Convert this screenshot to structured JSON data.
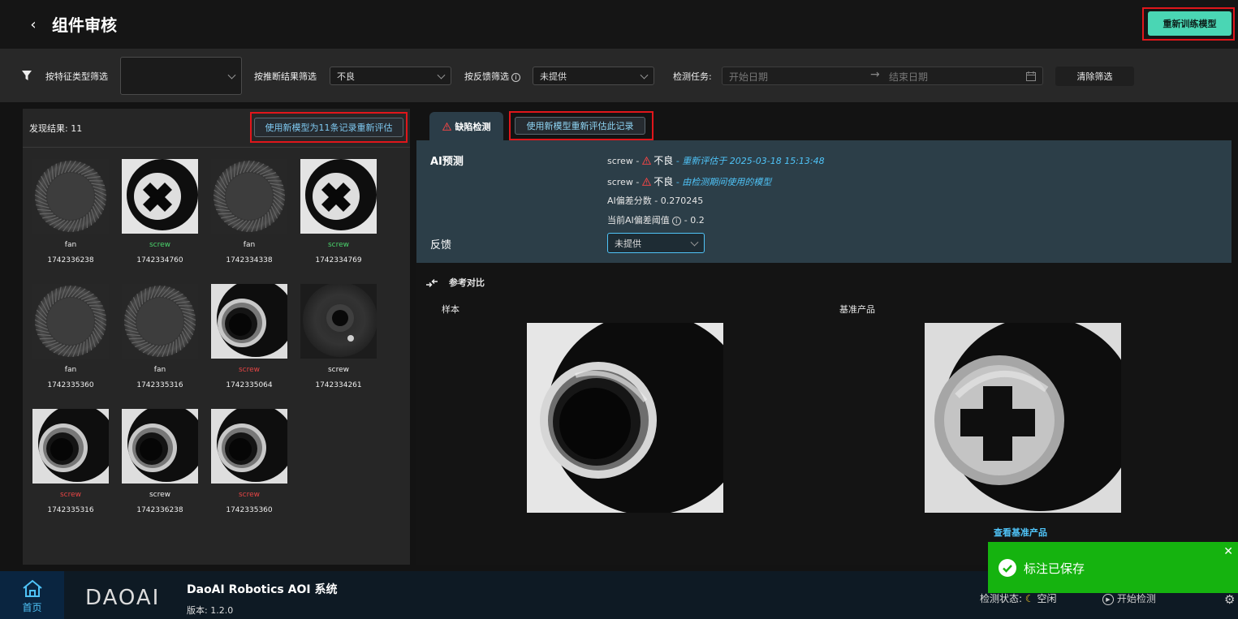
{
  "header": {
    "back_icon": "chevron-left-icon",
    "title": "组件审核",
    "retrain_label": "重新训练模型"
  },
  "filters": {
    "funnel_icon": "funnel-icon",
    "feature_type_label": "按特征类型筛选",
    "feature_type_value": "",
    "result_label": "按推断结果筛选",
    "result_value": "不良",
    "feedback_label": "按反馈筛选",
    "feedback_value": "未提供",
    "task_label": "检测任务:",
    "start_date_placeholder": "开始日期",
    "end_date_placeholder": "结束日期",
    "clear_label": "清除筛选"
  },
  "results": {
    "count_label": "发现结果: 11",
    "reeval_all_label": "使用新模型为11条记录重新评估",
    "items": [
      {
        "cls": "fan",
        "id": "1742336238",
        "img": "fan",
        "color": "#eeeeee"
      },
      {
        "cls": "screw",
        "id": "1742334760",
        "img": "cross",
        "color": "#4ad36b"
      },
      {
        "cls": "fan",
        "id": "1742334338",
        "img": "fan",
        "color": "#eeeeee"
      },
      {
        "cls": "screw",
        "id": "1742334769",
        "img": "cross",
        "color": "#4ad36b"
      },
      {
        "cls": "fan",
        "id": "1742335360",
        "img": "fan",
        "color": "#eeeeee"
      },
      {
        "cls": "fan",
        "id": "1742335316",
        "img": "fan",
        "color": "#eeeeee"
      },
      {
        "cls": "screw",
        "id": "1742335064",
        "img": "ring",
        "color": "#e64545"
      },
      {
        "cls": "screw",
        "id": "1742334261",
        "img": "dark",
        "color": "#eeeeee"
      },
      {
        "cls": "screw",
        "id": "1742335316",
        "img": "ring",
        "color": "#e64545"
      },
      {
        "cls": "screw",
        "id": "1742336238",
        "img": "ring",
        "color": "#eeeeee"
      },
      {
        "cls": "screw",
        "id": "1742335360",
        "img": "ring",
        "color": "#e64545"
      }
    ]
  },
  "detail": {
    "tab_label": "缺陷检测",
    "reeval_one_label": "使用新模型重新评估此记录",
    "ai_label": "AI预测",
    "pred1_cls": "screw",
    "pred1_result": "不良",
    "pred1_note": "重新评估于 2025-03-18 15:13:48",
    "pred2_cls": "screw",
    "pred2_result": "不良",
    "pred2_note": "由检测期间使用的模型",
    "score_text": "AI偏差分数 - 0.270245",
    "threshold_label": "当前AI偏差阈值",
    "threshold_value": "0.2",
    "feedback_label": "反馈",
    "feedback_value": "未提供"
  },
  "reference": {
    "title": "参考对比",
    "sample_label": "样本",
    "golden_label": "基准产品",
    "view_golden_label": "查看基准产品"
  },
  "footer": {
    "home_label": "首页",
    "brand_logo": "DAOAI",
    "app_name": "DaoAI Robotics AOI 系统",
    "version": "版本: 1.2.0",
    "status_label": "检测状态:",
    "status_value": "空闲",
    "start_label": "开始检测"
  },
  "toast": {
    "message": "标注已保存"
  },
  "colors": {
    "accent": "#4ad6b4",
    "link": "#4fc3f7",
    "ok": "#4ad36b",
    "ng": "#e64545",
    "toast": "#15b30f",
    "highlight": "#e0161b"
  }
}
